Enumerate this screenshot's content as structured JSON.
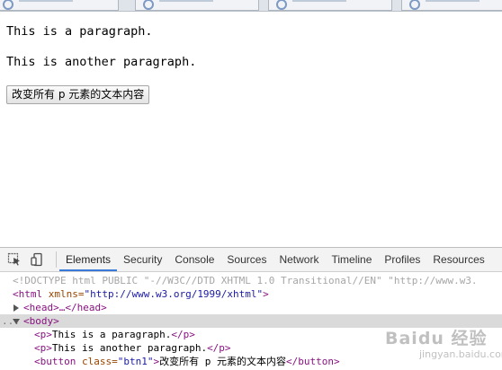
{
  "page": {
    "paragraphs": [
      "This is a paragraph.",
      "This is another paragraph."
    ],
    "button_label": "改变所有 p 元素的文本内容"
  },
  "devtools": {
    "tabs": [
      "Elements",
      "Security",
      "Console",
      "Sources",
      "Network",
      "Timeline",
      "Profiles",
      "Resources"
    ],
    "active_tab": "Elements",
    "icons": [
      "inspect-element-icon",
      "device-mode-icon"
    ],
    "code": {
      "doctype": "<!DOCTYPE html PUBLIC \"-//W3C//DTD XHTML 1.0 Transitional//EN\" \"http://www.w3.",
      "html_open": "<html",
      "html_attr": " xmlns=",
      "html_attr_val": "\"http://www.w3.org/1999/xhtml\"",
      "html_close": ">",
      "head_collapsed": "<head>…</head>",
      "body_open": "<body>",
      "ellipsis": "...",
      "p1_open": "<p>",
      "p1_text": "This is a paragraph.",
      "p1_close": "</p>",
      "p2_open": "<p>",
      "p2_text": "This is another paragraph.",
      "p2_close": "</p>",
      "btn_open": "<button",
      "btn_attr": " class=",
      "btn_attr_val": "\"btn1\"",
      "btn_gt": ">",
      "btn_text": "改变所有 p 元素的文本内容",
      "btn_close": "</button>"
    }
  },
  "watermark": {
    "brand": "Baidu 经验",
    "sub": "jingyan.baidu.com"
  },
  "colors": {
    "active_tab_underline": "#3879d9",
    "selected_row": "#dadada",
    "tag": "#881280",
    "attr": "#994500",
    "attr_value": "#1a1aa6"
  }
}
